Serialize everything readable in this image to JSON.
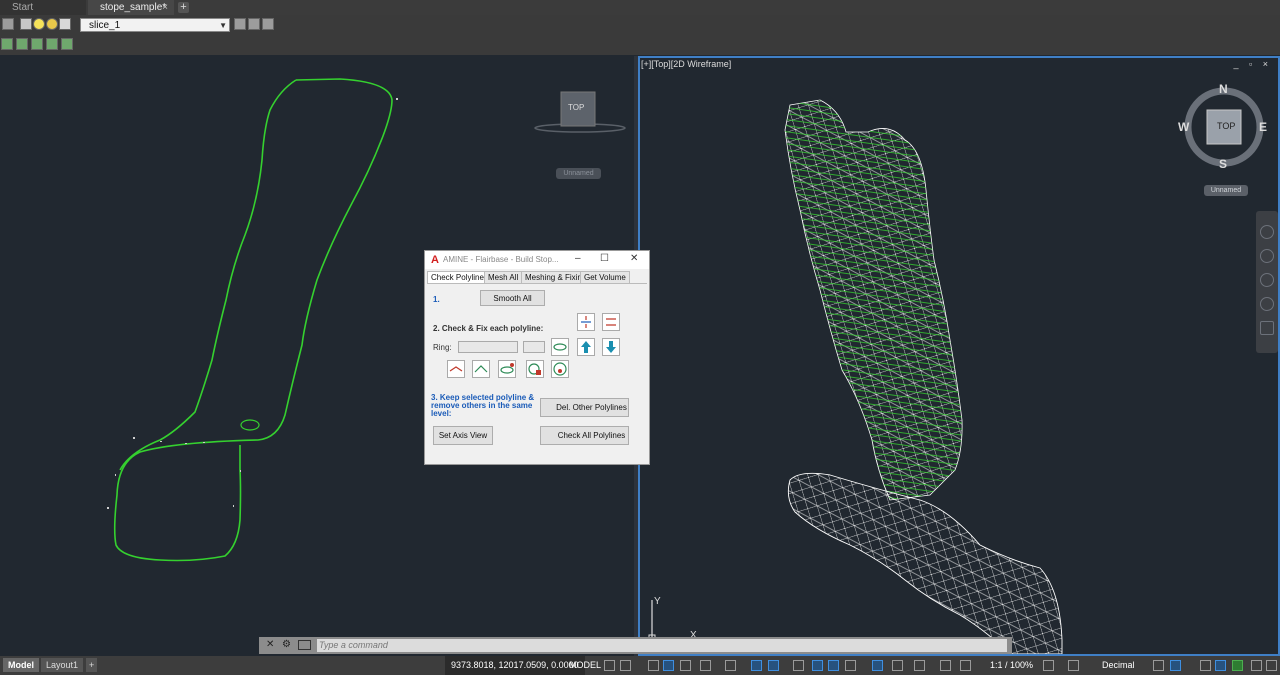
{
  "tabs": {
    "start": "Start",
    "active_file": "stope_sample*",
    "close": "×",
    "add": "+"
  },
  "toolbar": {
    "layer_name": "slice_1"
  },
  "right_viewport": {
    "label": "[+][Top][2D Wireframe]",
    "controls": "_ ▫ ×"
  },
  "viewcube": {
    "left_top": "TOP",
    "left_unnamed": "Unnamed",
    "right_top": "TOP",
    "right_unnamed": "Unnamed"
  },
  "compass": {
    "n": "N",
    "s": "S",
    "e": "E",
    "w": "W"
  },
  "ucs": {
    "y": "Y",
    "x": "X"
  },
  "dialog": {
    "title": "AMINE - Flairbase - Build Stop...",
    "tabs": [
      "Check Polylines",
      "Mesh All",
      "Meshing & Fixing",
      "Get Volume"
    ],
    "step1": "1.",
    "smooth_all": "Smooth All",
    "step2": "2. Check & Fix each polyline:",
    "ring_label": "Ring:",
    "step3_l1": "3. Keep selected polyline &",
    "step3_l2": "remove others in the same",
    "step3_l3": "level:",
    "del_other": "Del. Other Polylines",
    "set_axis": "Set Axis View",
    "check_all": "Check All Polylines"
  },
  "command_line": {
    "placeholder": "Type a command"
  },
  "status_bar": {
    "model_tab": "Model",
    "layout_tab": "Layout1",
    "add_tab": "+",
    "coordinates": "9373.8018, 12017.0509, 0.0000",
    "space": "MODEL",
    "scale": "1:1 / 100%",
    "units": "Decimal"
  },
  "colors": {
    "accent": "#3f7fc6",
    "polyline": "#35d12f",
    "mesh": "#ffffff",
    "background": "#212830"
  }
}
